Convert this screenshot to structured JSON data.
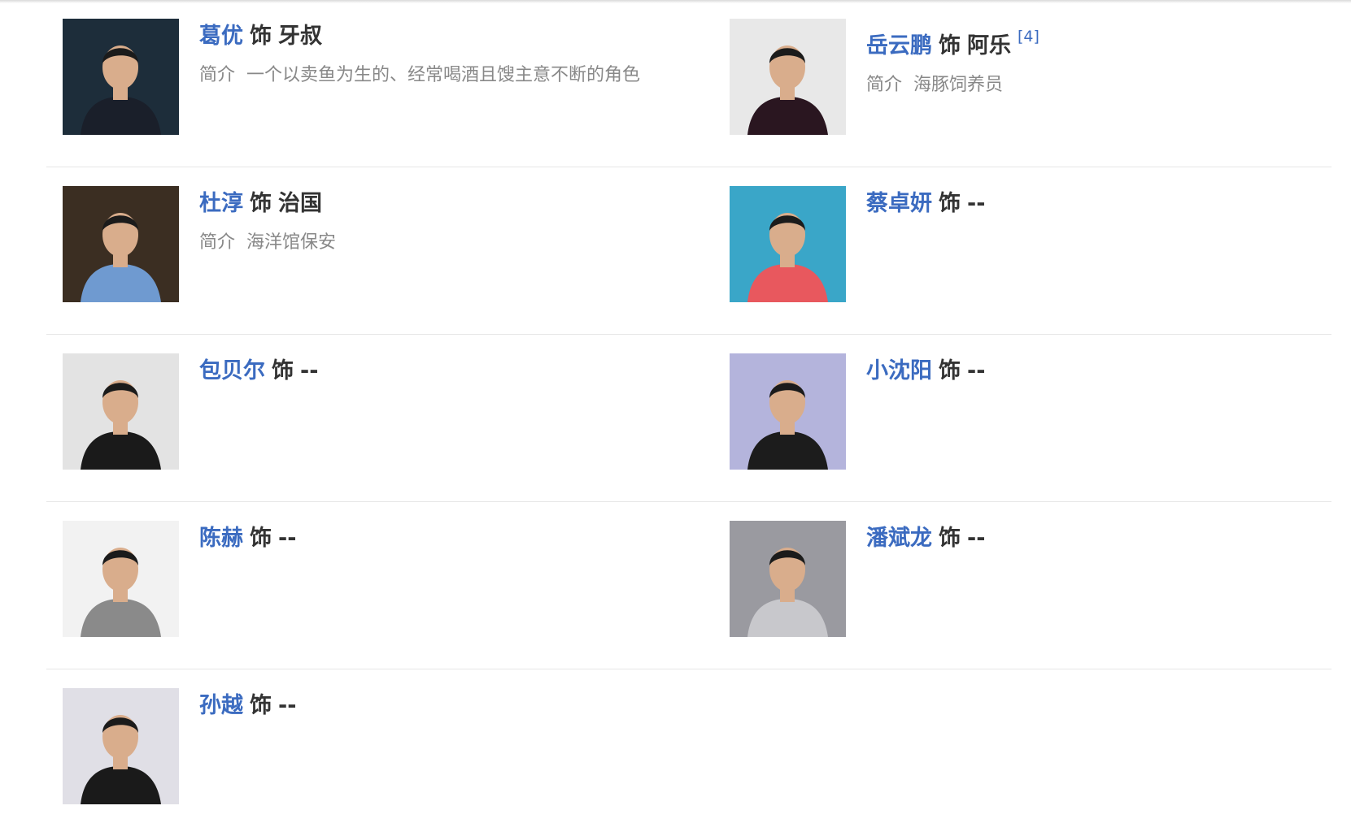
{
  "cast": [
    {
      "actor": "葛优",
      "shi": "饰",
      "role": "牙叔",
      "ref": "",
      "intro_label": "简介",
      "intro": "一个以卖鱼为生的、经常喝酒且馊主意不断的角色",
      "photo_icon": "actor-photo-icon",
      "photo_bg": "#1d2d3a"
    },
    {
      "actor": "岳云鹏",
      "shi": "饰",
      "role": "阿乐",
      "ref": "[4]",
      "intro_label": "简介",
      "intro": "海豚饲养员",
      "photo_icon": "actor-photo-icon",
      "photo_bg": "#e8e8e8"
    },
    {
      "actor": "杜淳",
      "shi": "饰",
      "role": "治国",
      "ref": "",
      "intro_label": "简介",
      "intro": "海洋馆保安",
      "photo_icon": "actor-photo-icon",
      "photo_bg": "#3b2e22"
    },
    {
      "actor": "蔡卓妍",
      "shi": "饰",
      "role": "--",
      "ref": "",
      "intro_label": "",
      "intro": "",
      "photo_icon": "actor-photo-icon",
      "photo_bg": "#3aa6c8"
    },
    {
      "actor": "包贝尔",
      "shi": "饰",
      "role": "--",
      "ref": "",
      "intro_label": "",
      "intro": "",
      "photo_icon": "actor-photo-icon",
      "photo_bg": "#e3e3e3"
    },
    {
      "actor": "小沈阳",
      "shi": "饰",
      "role": "--",
      "ref": "",
      "intro_label": "",
      "intro": "",
      "photo_icon": "actor-photo-icon",
      "photo_bg": "#b4b4dc"
    },
    {
      "actor": "陈赫",
      "shi": "饰",
      "role": "--",
      "ref": "",
      "intro_label": "",
      "intro": "",
      "photo_icon": "actor-photo-icon",
      "photo_bg": "#f2f2f2"
    },
    {
      "actor": "潘斌龙",
      "shi": "饰",
      "role": "--",
      "ref": "",
      "intro_label": "",
      "intro": "",
      "photo_icon": "actor-photo-icon",
      "photo_bg": "#9a9aa0"
    },
    {
      "actor": "孙越",
      "shi": "饰",
      "role": "--",
      "ref": "",
      "intro_label": "",
      "intro": "",
      "photo_icon": "actor-photo-icon",
      "photo_bg": "#e0dfe6"
    }
  ],
  "colors": {
    "link": "#3b6bc0",
    "text": "#333333",
    "muted": "#888888",
    "divider": "#e6e6e6"
  }
}
